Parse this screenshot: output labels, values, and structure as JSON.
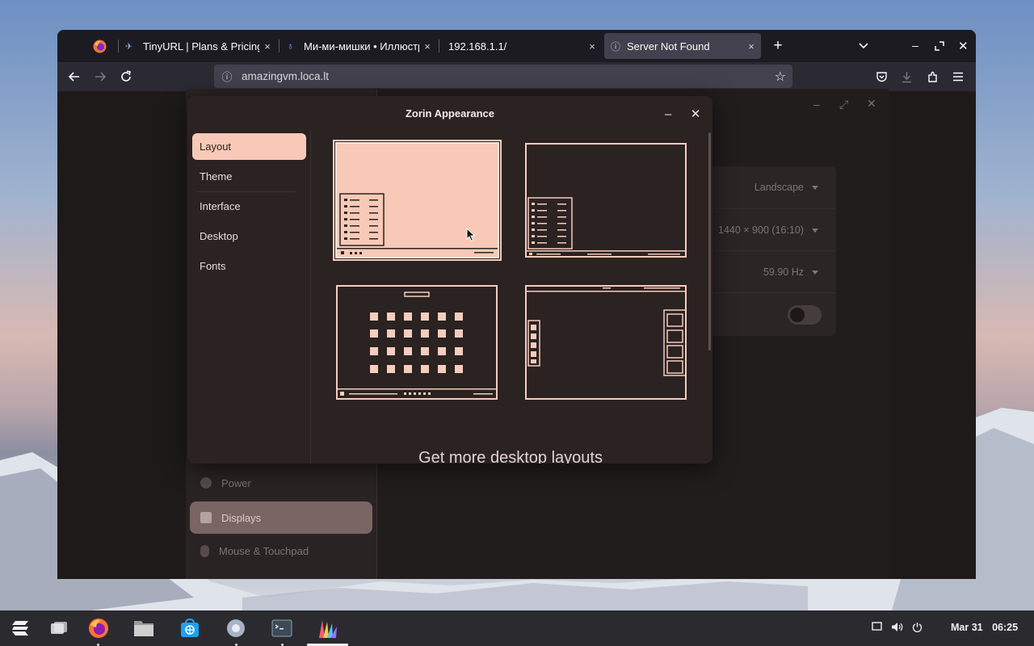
{
  "browser": {
    "tabs": [
      {
        "title": "TinyURL | Plans & Pricing",
        "close": "×"
      },
      {
        "title": "Ми-ми-мишки • Иллюстр",
        "close": "×"
      },
      {
        "title": "192.168.1.1/",
        "close": "×"
      },
      {
        "title": "Server Not Found",
        "close": "×"
      }
    ],
    "new_tab": "+",
    "url": "amazingvm.loca.lt"
  },
  "settings": {
    "sidebar": [
      {
        "label": "Power"
      },
      {
        "label": "Displays"
      },
      {
        "label": "Mouse & Touchpad"
      }
    ],
    "display": {
      "orientation": "Landscape",
      "resolution": "1440 × 900 (16:10)",
      "refresh_rate": "59.90 Hz"
    }
  },
  "appearance": {
    "title": "Zorin Appearance",
    "nav": [
      {
        "label": "Layout",
        "selected": true
      },
      {
        "label": "Theme"
      },
      {
        "label": "Interface"
      },
      {
        "label": "Desktop"
      },
      {
        "label": "Fonts"
      }
    ],
    "more_link": "Get more desktop layouts"
  },
  "taskbar": {
    "date": "Mar 31",
    "time": "06:25"
  },
  "colors": {
    "accent": "#f8c9b6",
    "window_bg": "#2b2222",
    "taskbar": "#2b2b2f"
  }
}
